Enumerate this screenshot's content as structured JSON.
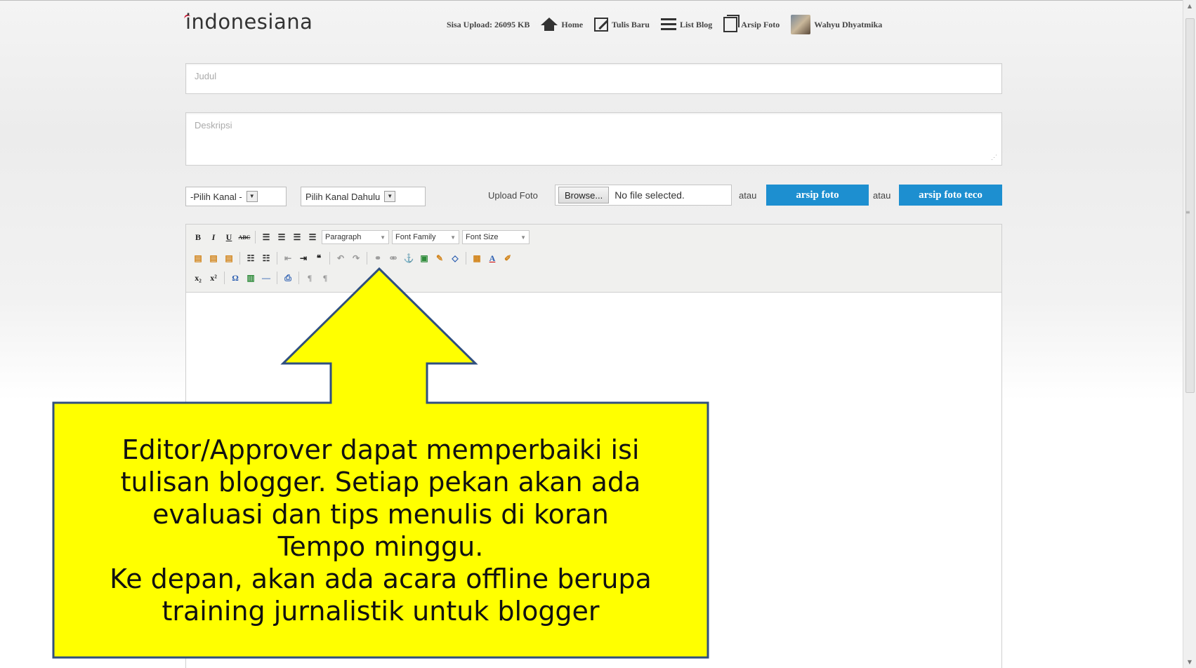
{
  "header": {
    "logo_text": "indonesiana",
    "upload_quota": "Sisa Upload: 26095 KB",
    "nav": {
      "home": "Home",
      "new_post": "Tulis Baru",
      "list_blog": "List Blog",
      "photo_archive": "Arsip Foto",
      "user_name": "Wahyu Dhyatmika"
    }
  },
  "form": {
    "title_placeholder": "Judul",
    "description_placeholder": "Deskripsi",
    "channel_select": "-Pilih Kanal -",
    "subchannel_select": "Pilih Kanal Dahulu",
    "upload_label": "Upload Foto",
    "browse_label": "Browse...",
    "file_status": "No file selected.",
    "or_text": "atau",
    "archive_button": "arsip foto",
    "archive_teco_button": "arsip foto teco"
  },
  "editor": {
    "format_select": "Paragraph",
    "font_family_select": "Font Family",
    "font_size_select": "Font Size",
    "toolbar_row1": [
      "B",
      "I",
      "U",
      "ABC"
    ],
    "toolbar_row3": [
      "x₂",
      "x²",
      "Ω"
    ]
  },
  "callout": {
    "line1": "Editor/Approver dapat memperbaiki isi",
    "line2": "tulisan blogger. Setiap pekan akan ada",
    "line3": "evaluasi dan tips menulis di koran",
    "line4": "Tempo minggu.",
    "line5": "Ke depan, akan ada acara offline berupa",
    "line6": "training jurnalistik untuk blogger",
    "fill_color": "#ffff00",
    "border_color": "#2f4f7f"
  },
  "colors": {
    "accent_button": "#1d8fd0",
    "logo_mark": "#c8102e"
  }
}
